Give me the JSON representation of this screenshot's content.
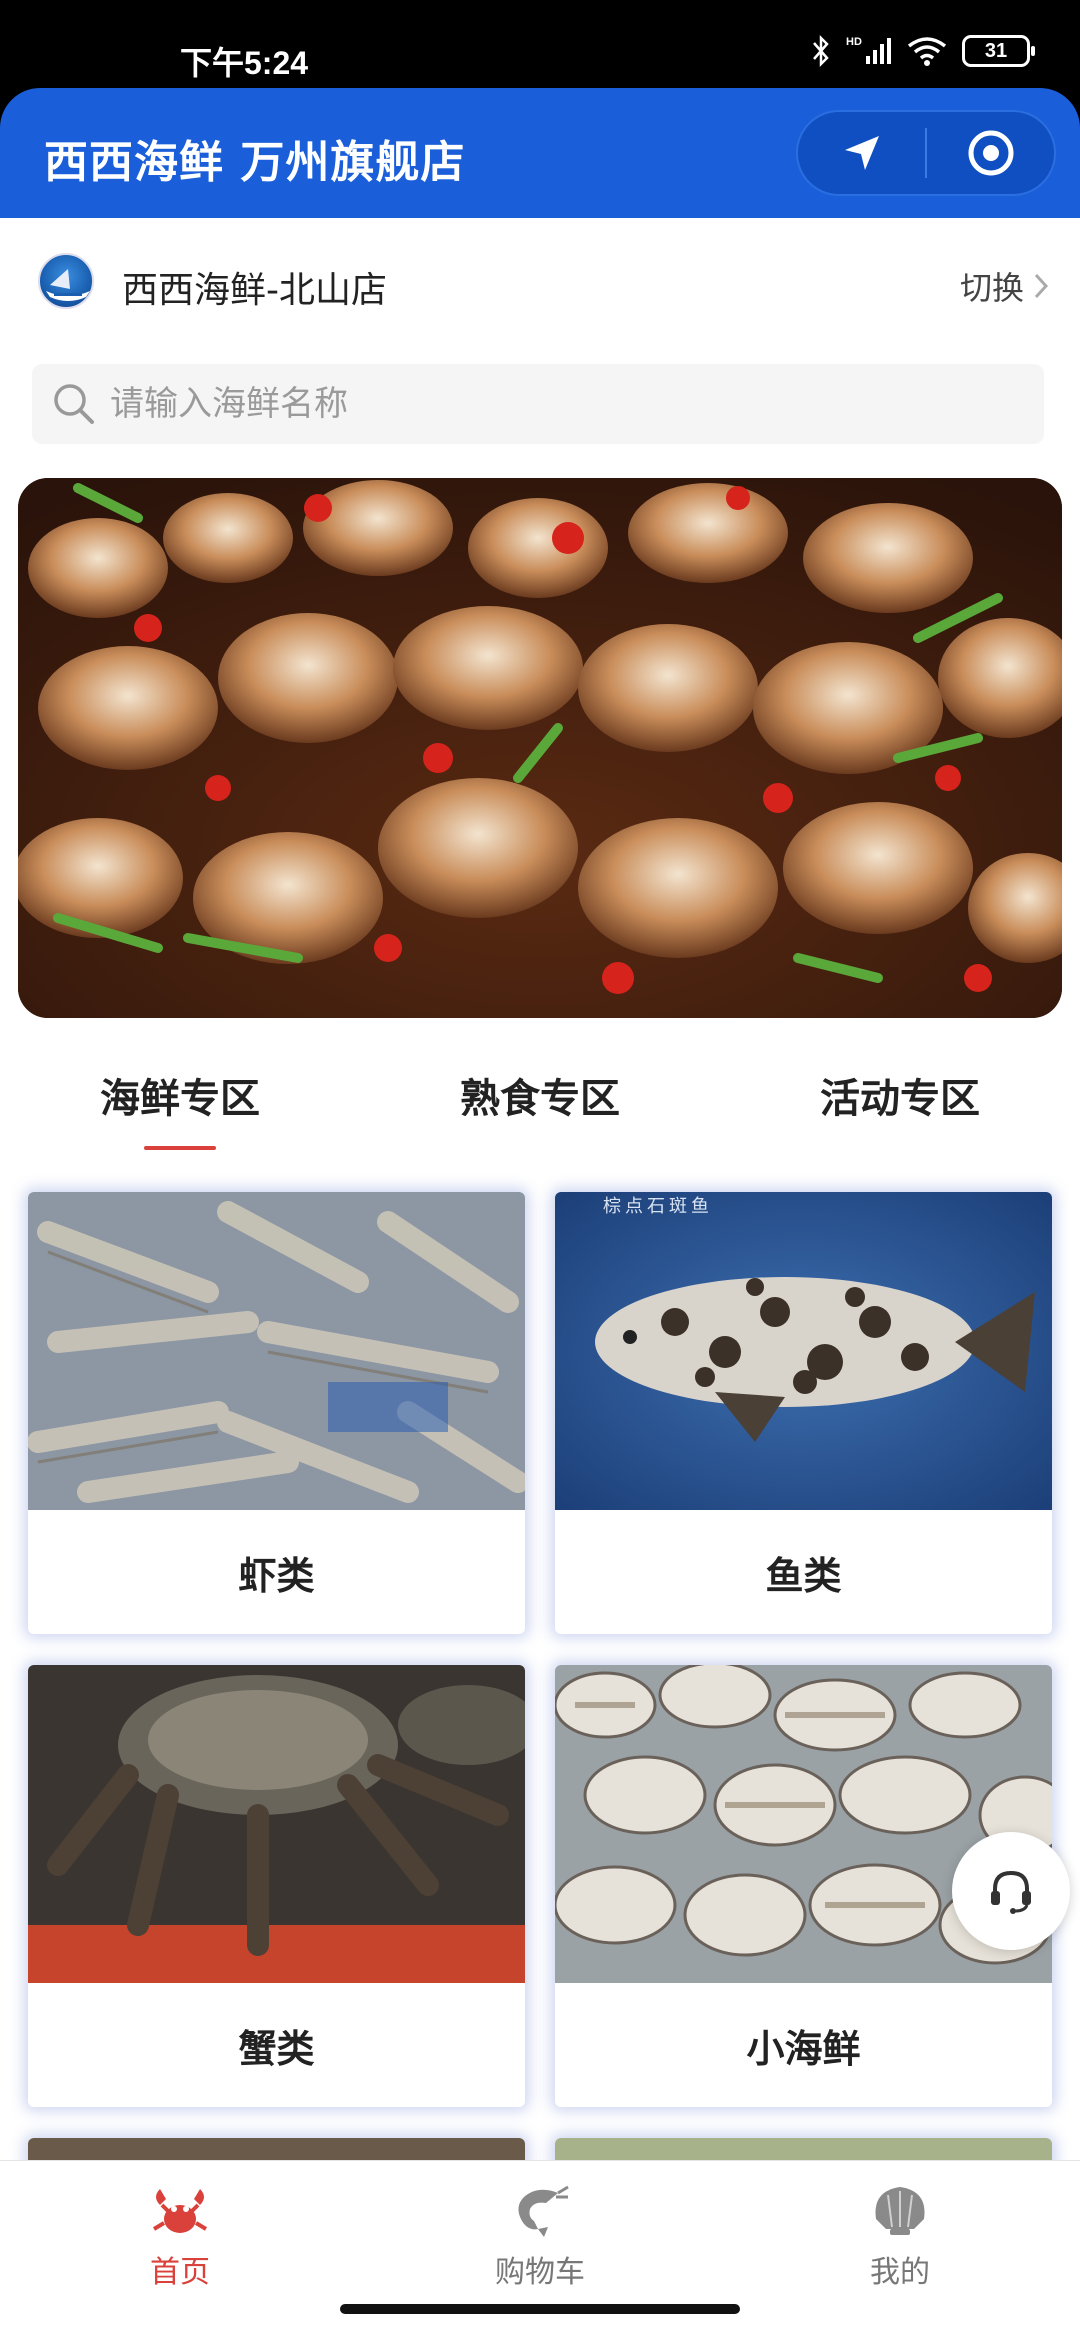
{
  "status_bar": {
    "time": "下午5:24",
    "network": "HD",
    "battery": "31"
  },
  "header": {
    "title": "西西海鲜 万州旗舰店"
  },
  "store": {
    "name": "西西海鲜-北山店",
    "switch_label": "切换"
  },
  "search": {
    "placeholder": "请输入海鲜名称"
  },
  "tabs": [
    {
      "label": "海鲜专区",
      "active": true
    },
    {
      "label": "熟食专区",
      "active": false
    },
    {
      "label": "活动专区",
      "active": false
    }
  ],
  "categories": [
    {
      "label": "虾类"
    },
    {
      "label": "鱼类",
      "image_caption": "棕点石斑鱼"
    },
    {
      "label": "蟹类"
    },
    {
      "label": "小海鲜"
    }
  ],
  "tabbar": [
    {
      "label": "首页",
      "icon": "crab-icon",
      "active": true
    },
    {
      "label": "购物车",
      "icon": "shrimp-icon",
      "active": false
    },
    {
      "label": "我的",
      "icon": "shell-icon",
      "active": false
    }
  ],
  "colors": {
    "primary": "#1a5fd9",
    "accent": "#d9413a"
  }
}
